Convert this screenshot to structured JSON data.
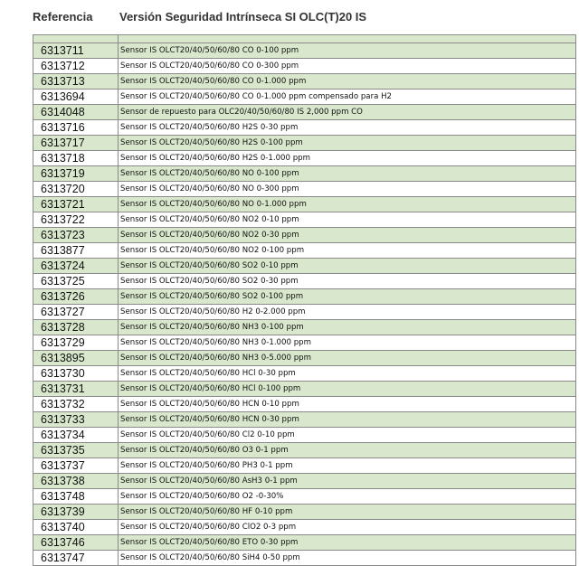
{
  "header": {
    "reference_label": "Referencia",
    "description_label": "Versión Seguridad Intrínseca SI OLC(T)20 IS"
  },
  "rows": [
    {
      "ref": "6313711",
      "desc": "Sensor IS OLCT20/40/50/60/80 CO 0-100 ppm"
    },
    {
      "ref": "6313712",
      "desc": "Sensor IS OLCT20/40/50/60/80 CO 0-300 ppm"
    },
    {
      "ref": "6313713",
      "desc": "Sensor IS OLCT20/40/50/60/80 CO 0-1.000 ppm"
    },
    {
      "ref": "6313694",
      "desc": "Sensor IS OLCT20/40/50/60/80 CO 0-1.000 ppm compensado para H2"
    },
    {
      "ref": "6314048",
      "desc": "Sensor de repuesto para OLC20/40/50/60/80 IS 2,000 ppm CO"
    },
    {
      "ref": "6313716",
      "desc": "Sensor IS OLCT20/40/50/60/80 H2S 0-30 ppm"
    },
    {
      "ref": "6313717",
      "desc": "Sensor IS OLCT20/40/50/60/80 H2S 0-100 ppm"
    },
    {
      "ref": "6313718",
      "desc": "Sensor IS OLCT20/40/50/60/80 H2S 0-1.000 ppm"
    },
    {
      "ref": "6313719",
      "desc": "Sensor IS OLCT20/40/50/60/80 NO 0-100 ppm"
    },
    {
      "ref": "6313720",
      "desc": "Sensor IS OLCT20/40/50/60/80 NO 0-300 ppm"
    },
    {
      "ref": "6313721",
      "desc": "Sensor IS OLCT20/40/50/60/80 NO 0-1.000 ppm"
    },
    {
      "ref": "6313722",
      "desc": "Sensor IS OLCT20/40/50/60/80 NO2 0-10 ppm"
    },
    {
      "ref": "6313723",
      "desc": "Sensor IS OLCT20/40/50/60/80 NO2 0-30 ppm"
    },
    {
      "ref": "6313877",
      "desc": "Sensor IS OLCT20/40/50/60/80 NO2 0-100 ppm"
    },
    {
      "ref": "6313724",
      "desc": "Sensor IS OLCT20/40/50/60/80 SO2 0-10 ppm"
    },
    {
      "ref": "6313725",
      "desc": "Sensor IS OLCT20/40/50/60/80 SO2 0-30 ppm"
    },
    {
      "ref": "6313726",
      "desc": "Sensor IS OLCT20/40/50/60/80 SO2 0-100 ppm"
    },
    {
      "ref": "6313727",
      "desc": "Sensor IS OLCT20/40/50/60/80 H2 0-2.000 ppm"
    },
    {
      "ref": "6313728",
      "desc": "Sensor IS OLCT20/40/50/60/80 NH3 0-100 ppm"
    },
    {
      "ref": "6313729",
      "desc": "Sensor IS OLCT20/40/50/60/80 NH3 0-1.000 ppm"
    },
    {
      "ref": "6313895",
      "desc": "Sensor IS OLCT20/40/50/60/80 NH3 0-5.000 ppm"
    },
    {
      "ref": "6313730",
      "desc": "Sensor IS OLCT20/40/50/60/80 HCl 0-30 ppm"
    },
    {
      "ref": "6313731",
      "desc": "Sensor IS OLCT20/40/50/60/80 HCl 0-100 ppm"
    },
    {
      "ref": "6313732",
      "desc": "Sensor IS OLCT20/40/50/60/80 HCN 0-10 ppm"
    },
    {
      "ref": "6313733",
      "desc": "Sensor IS OLCT20/40/50/60/80 HCN 0-30 ppm"
    },
    {
      "ref": "6313734",
      "desc": "Sensor IS OLCT20/40/50/60/80 Cl2 0-10 ppm"
    },
    {
      "ref": "6313735",
      "desc": "Sensor IS OLCT20/40/50/60/80 O3 0-1 ppm"
    },
    {
      "ref": "6313737",
      "desc": "Sensor IS OLCT20/40/50/60/80 PH3 0-1 ppm"
    },
    {
      "ref": "6313738",
      "desc": "Sensor IS OLCT20/40/50/60/80 AsH3 0-1 ppm"
    },
    {
      "ref": "6313748",
      "desc": "Sensor IS OLCT20/40/50/60/80 O2 -0-30%"
    },
    {
      "ref": "6313739",
      "desc": "Sensor IS OLCT20/40/50/60/80 HF 0-10 ppm"
    },
    {
      "ref": "6313740",
      "desc": "Sensor IS OLCT20/40/50/60/80 ClO2 0-3 ppm"
    },
    {
      "ref": "6313746",
      "desc": "Sensor IS OLCT20/40/50/60/80 ETO 0-30 ppm"
    },
    {
      "ref": "6313747",
      "desc": "Sensor IS OLCT20/40/50/60/80 SiH4 0-50 ppm"
    }
  ],
  "colors": {
    "row_shade": "#d9e8cc",
    "border": "#8a8a8a"
  }
}
